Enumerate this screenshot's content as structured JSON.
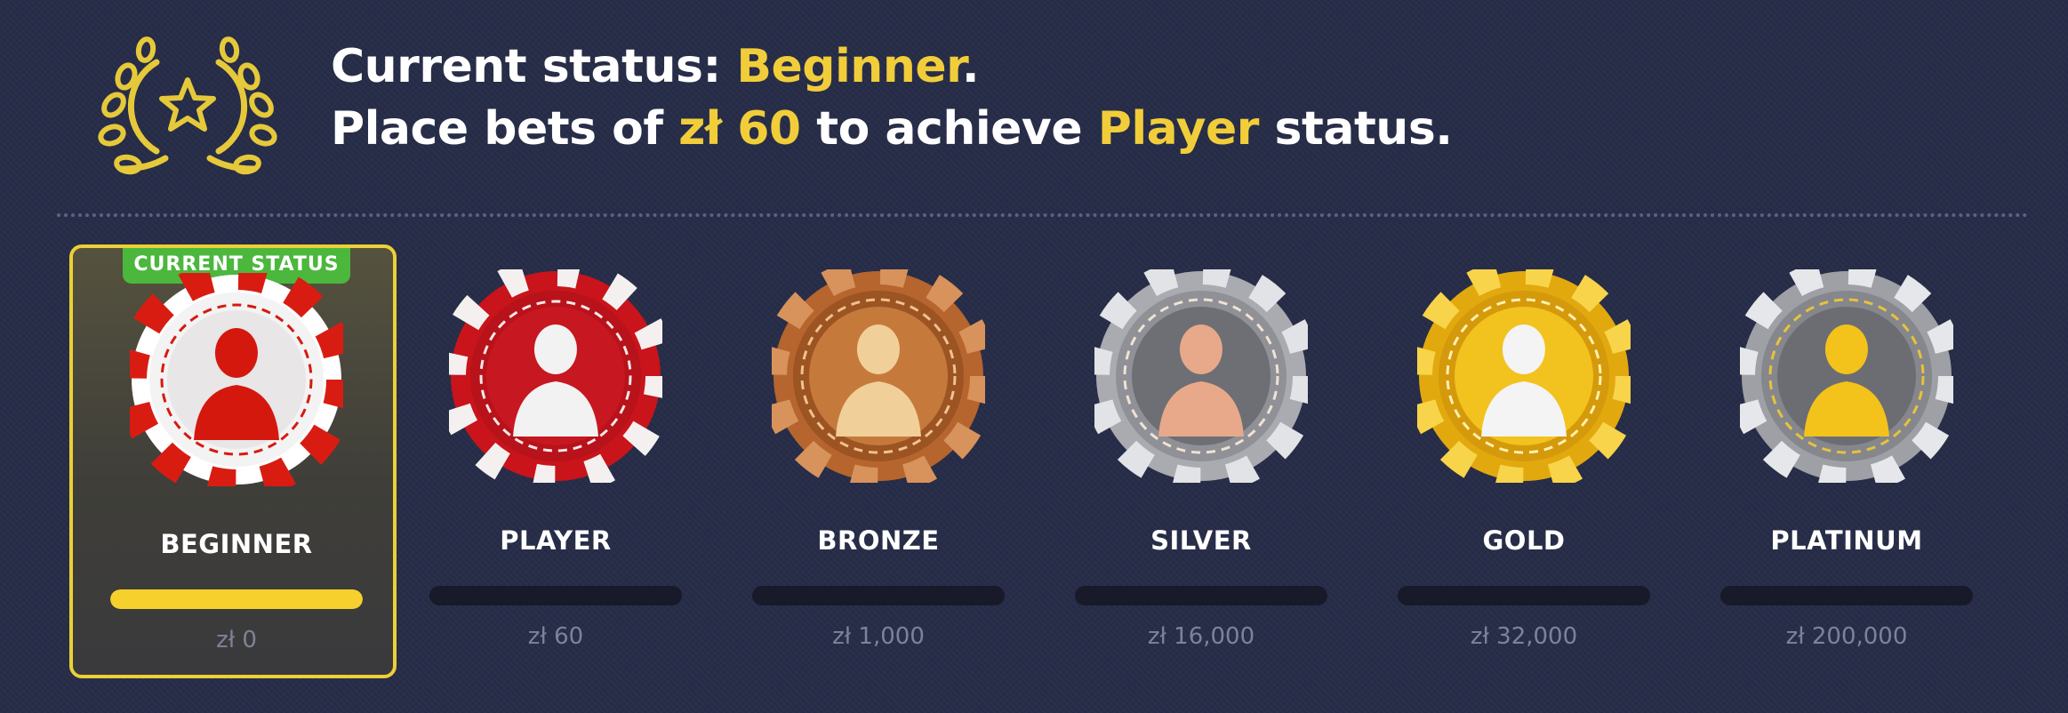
{
  "header": {
    "line1_prefix": "Current status: ",
    "line1_status": "Beginner",
    "line1_suffix": ".",
    "line2_prefix": "Place bets of ",
    "line2_amount": "zł 60",
    "line2_middle": " to achieve ",
    "line2_target": "Player",
    "line2_suffix": " status.",
    "icon": "laurel-star-icon"
  },
  "colors": {
    "background": "#272d48",
    "highlight": "#f1cd3a",
    "current_border": "#ecd035",
    "badge": "#4cb73d",
    "progress_fill": "#f6d12e",
    "progress_track": "#181a29"
  },
  "current_badge": "CURRENT STATUS",
  "levels": [
    {
      "name": "BEGINNER",
      "threshold": "zł 0",
      "progress": 1.0,
      "current": true,
      "chip": "red-white-chip-icon"
    },
    {
      "name": "PLAYER",
      "threshold": "zł 60",
      "progress": 0,
      "current": false,
      "chip": "red-chip-icon"
    },
    {
      "name": "BRONZE",
      "threshold": "zł 1,000",
      "progress": 0,
      "current": false,
      "chip": "bronze-chip-icon"
    },
    {
      "name": "SILVER",
      "threshold": "zł 16,000",
      "progress": 0,
      "current": false,
      "chip": "silver-chip-icon"
    },
    {
      "name": "GOLD",
      "threshold": "zł 32,000",
      "progress": 0,
      "current": false,
      "chip": "gold-chip-icon"
    },
    {
      "name": "PLATINUM",
      "threshold": "zł 200,000",
      "progress": 0,
      "current": false,
      "chip": "platinum-chip-icon"
    }
  ]
}
